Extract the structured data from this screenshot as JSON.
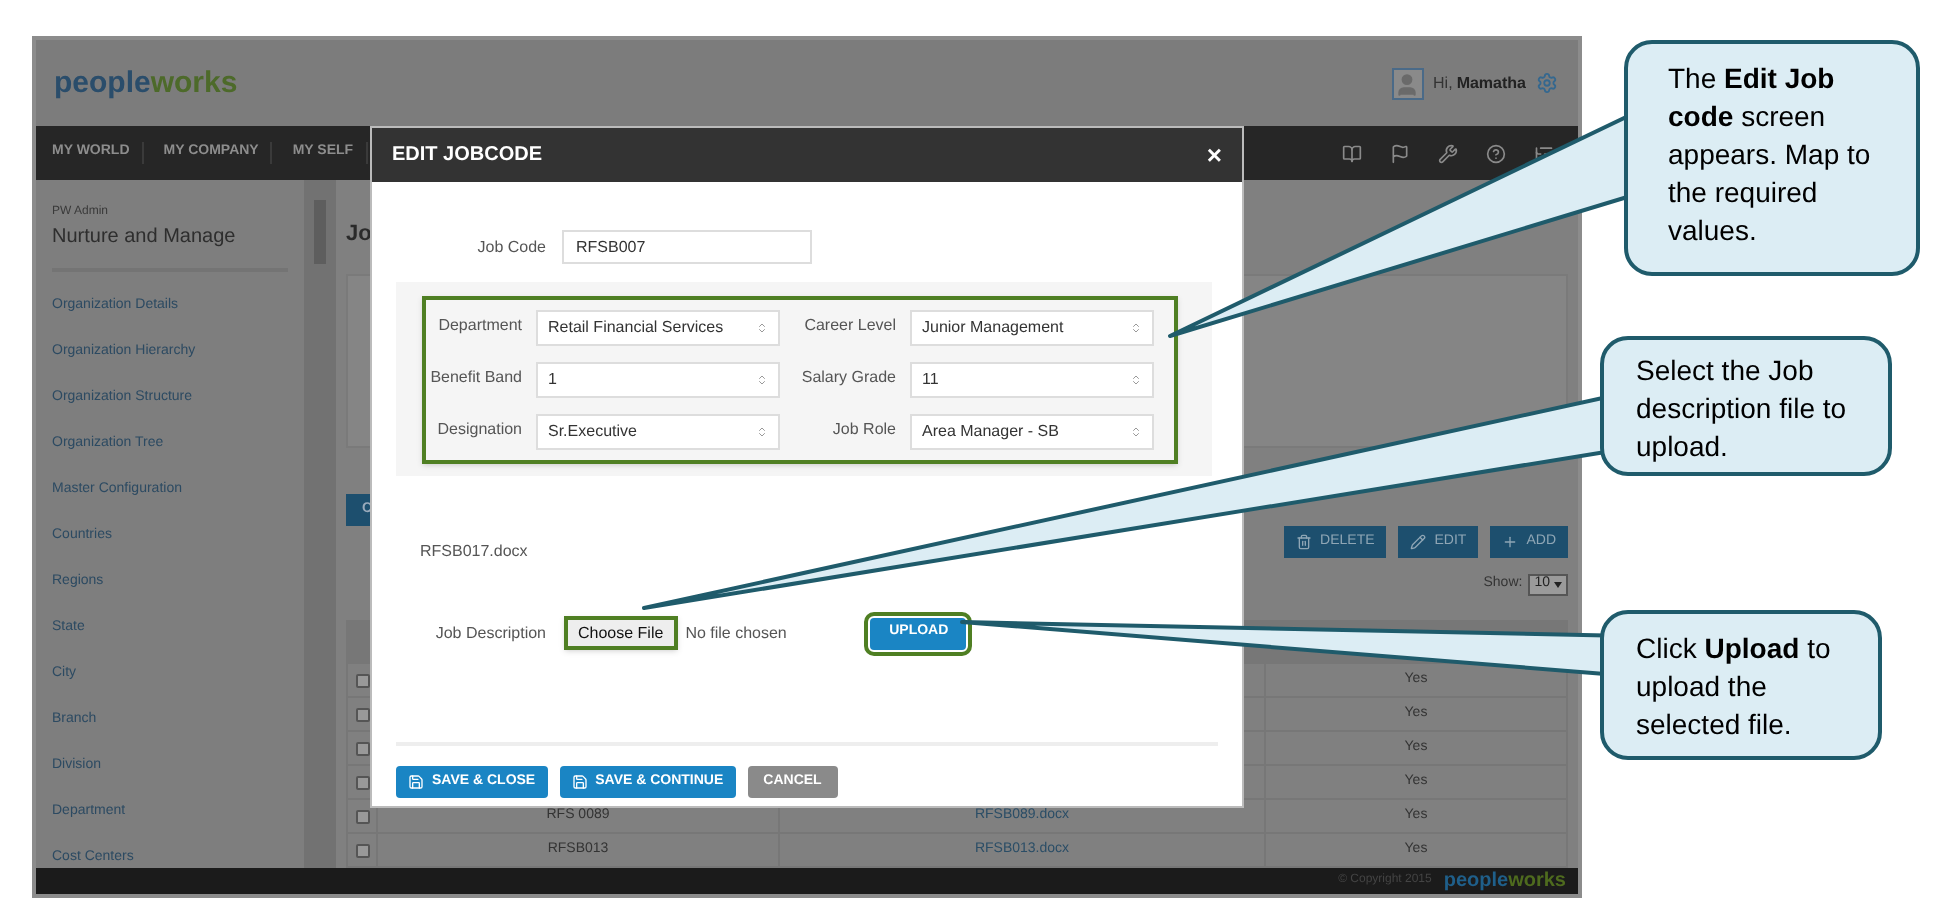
{
  "app": {
    "logo": [
      "people",
      "works"
    ],
    "greeting": "Hi,",
    "user": "Mamatha",
    "nav": [
      {
        "label": "MY WORLD"
      },
      {
        "label": "MY COMPANY"
      },
      {
        "label": "MY SELF"
      }
    ],
    "sidebar": {
      "role": "PW Admin",
      "title": "Nurture and Manage",
      "items": [
        "Organization Details",
        "Organization Hierarchy",
        "Organization Structure",
        "Organization Tree",
        "Master Configuration",
        "Countries",
        "Regions",
        "State",
        "City",
        "Branch",
        "Division",
        "Department",
        "Cost Centers"
      ]
    },
    "page_title": "Jo",
    "cut_button": "C",
    "toolbar": [
      {
        "kind": "delete",
        "label": "DELETE"
      },
      {
        "kind": "edit",
        "label": "EDIT"
      },
      {
        "kind": "add",
        "label": "ADD"
      }
    ],
    "show_label": "Show:",
    "show_value": "10",
    "table": {
      "rows": [
        {
          "checked": false,
          "column_4": "Yes"
        },
        {
          "checked": false,
          "column_4": "Yes"
        },
        {
          "checked": false,
          "column_4": "Yes"
        },
        {
          "checked": false,
          "column_4": "Yes"
        },
        {
          "checked": false,
          "column_2": "RFS 0089",
          "column_3": "RFSB089.docx",
          "column_4": "Yes"
        },
        {
          "checked": false,
          "column_2": "RFSB013",
          "column_3": "RFSB013.docx",
          "column_4": "Yes"
        }
      ]
    },
    "footer": {
      "copyright": "© Copyright 2015",
      "logo": [
        "people",
        "works"
      ]
    }
  },
  "modal": {
    "title": "EDIT JOBCODE",
    "close": "×",
    "job_code": {
      "label": "Job Code",
      "value": "RFSB007"
    },
    "mapping": {
      "highlighted": true,
      "fields": [
        {
          "label": "Department",
          "value": "Retail Financial Services"
        },
        {
          "label": "Career Level",
          "value": "Junior Management"
        },
        {
          "label": "Benefit Band",
          "value": "1"
        },
        {
          "label": "Salary Grade",
          "value": "11"
        },
        {
          "label": "Designation",
          "value": "Sr.Executive"
        },
        {
          "label": "Job Role",
          "value": "Area Manager - SB"
        }
      ]
    },
    "current_file": "RFSB017.docx",
    "job_description": {
      "label": "Job Description",
      "choose_button": {
        "label": "Choose File",
        "highlighted": true
      },
      "file_status": "No file chosen",
      "upload_button": {
        "label": "UPLOAD",
        "highlighted": true
      }
    },
    "buttons": [
      {
        "kind": "save",
        "label": "SAVE & CLOSE"
      },
      {
        "kind": "save",
        "label": "SAVE & CONTINUE"
      },
      {
        "kind": "cancel",
        "label": "CANCEL"
      }
    ]
  },
  "callouts": [
    {
      "text": "The **Edit Job code** screen appears. Map to the required values."
    },
    {
      "text": "Select the Job description file to upload."
    },
    {
      "text": "Click **Upload** to upload the selected file."
    }
  ]
}
